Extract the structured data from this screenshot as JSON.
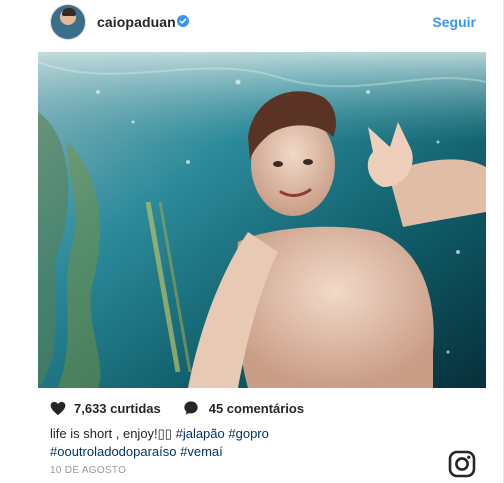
{
  "header": {
    "username": "caiopaduan",
    "verified_icon": "verified-badge-icon",
    "follow_label": "Seguir"
  },
  "post": {
    "image_alt": "underwater selfie",
    "likes_text": "7,633 curtidas",
    "comments_text": "45 comentários",
    "caption_text": "life is short , enjoy!",
    "caption_emoji": "▯▯",
    "hashtags_line1": [
      "#jalapão",
      "#gopro"
    ],
    "hashtags_line2": [
      "#ooutroladodoparaíso",
      "#vemaí"
    ],
    "date": "10 DE AGOSTO"
  },
  "colors": {
    "accent": "#3897f0",
    "hashtag": "#003569",
    "date": "#999999"
  }
}
